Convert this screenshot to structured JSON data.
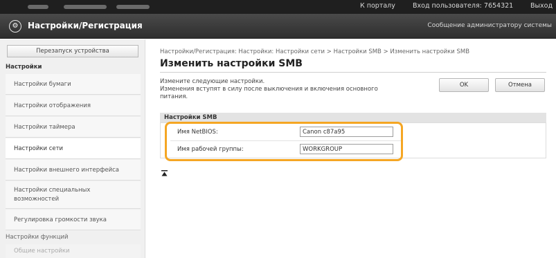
{
  "topbar": {
    "portal_link": "К порталу",
    "login_user": "Вход пользователя:  7654321",
    "logout": "Выход"
  },
  "header": {
    "title": "Настройки/Регистрация",
    "admin_message": "Сообщение администратору системы"
  },
  "sidebar": {
    "restart_button": "Перезапуск устройства",
    "settings_title": "Настройки",
    "items": [
      "Настройки бумаги",
      "Настройки отображения",
      "Настройки таймера",
      "Настройки сети",
      "Настройки внешнего интерфейса",
      "Настройки специальных возможностей",
      "Регулировка громкости звука"
    ],
    "accessibility_line2": "возможностей",
    "functions_title": "Настройки функций",
    "general_settings": "Общие настройки"
  },
  "main": {
    "breadcrumb": "Настройки/Регистрация: Настройки: Настройки сети > Настройки SMB > Изменить настройки SMB",
    "title": "Изменить настройки SMB",
    "desc_line1": "Измените следующие настройки.",
    "desc_line2": "Изменения вступят в силу после выключения и включения основного",
    "desc_line3": "питания.",
    "ok_button": "OK",
    "cancel_button": "Отмена",
    "smb_section": "Настройки SMB",
    "netbios_label": "Имя NetBIOS:",
    "netbios_value": "Canon c87a95",
    "workgroup_label": "Имя рабочей группы:",
    "workgroup_value": "WORKGROUP"
  },
  "colors": {
    "highlight": "#f5a623",
    "header": "#3a3a3a"
  }
}
